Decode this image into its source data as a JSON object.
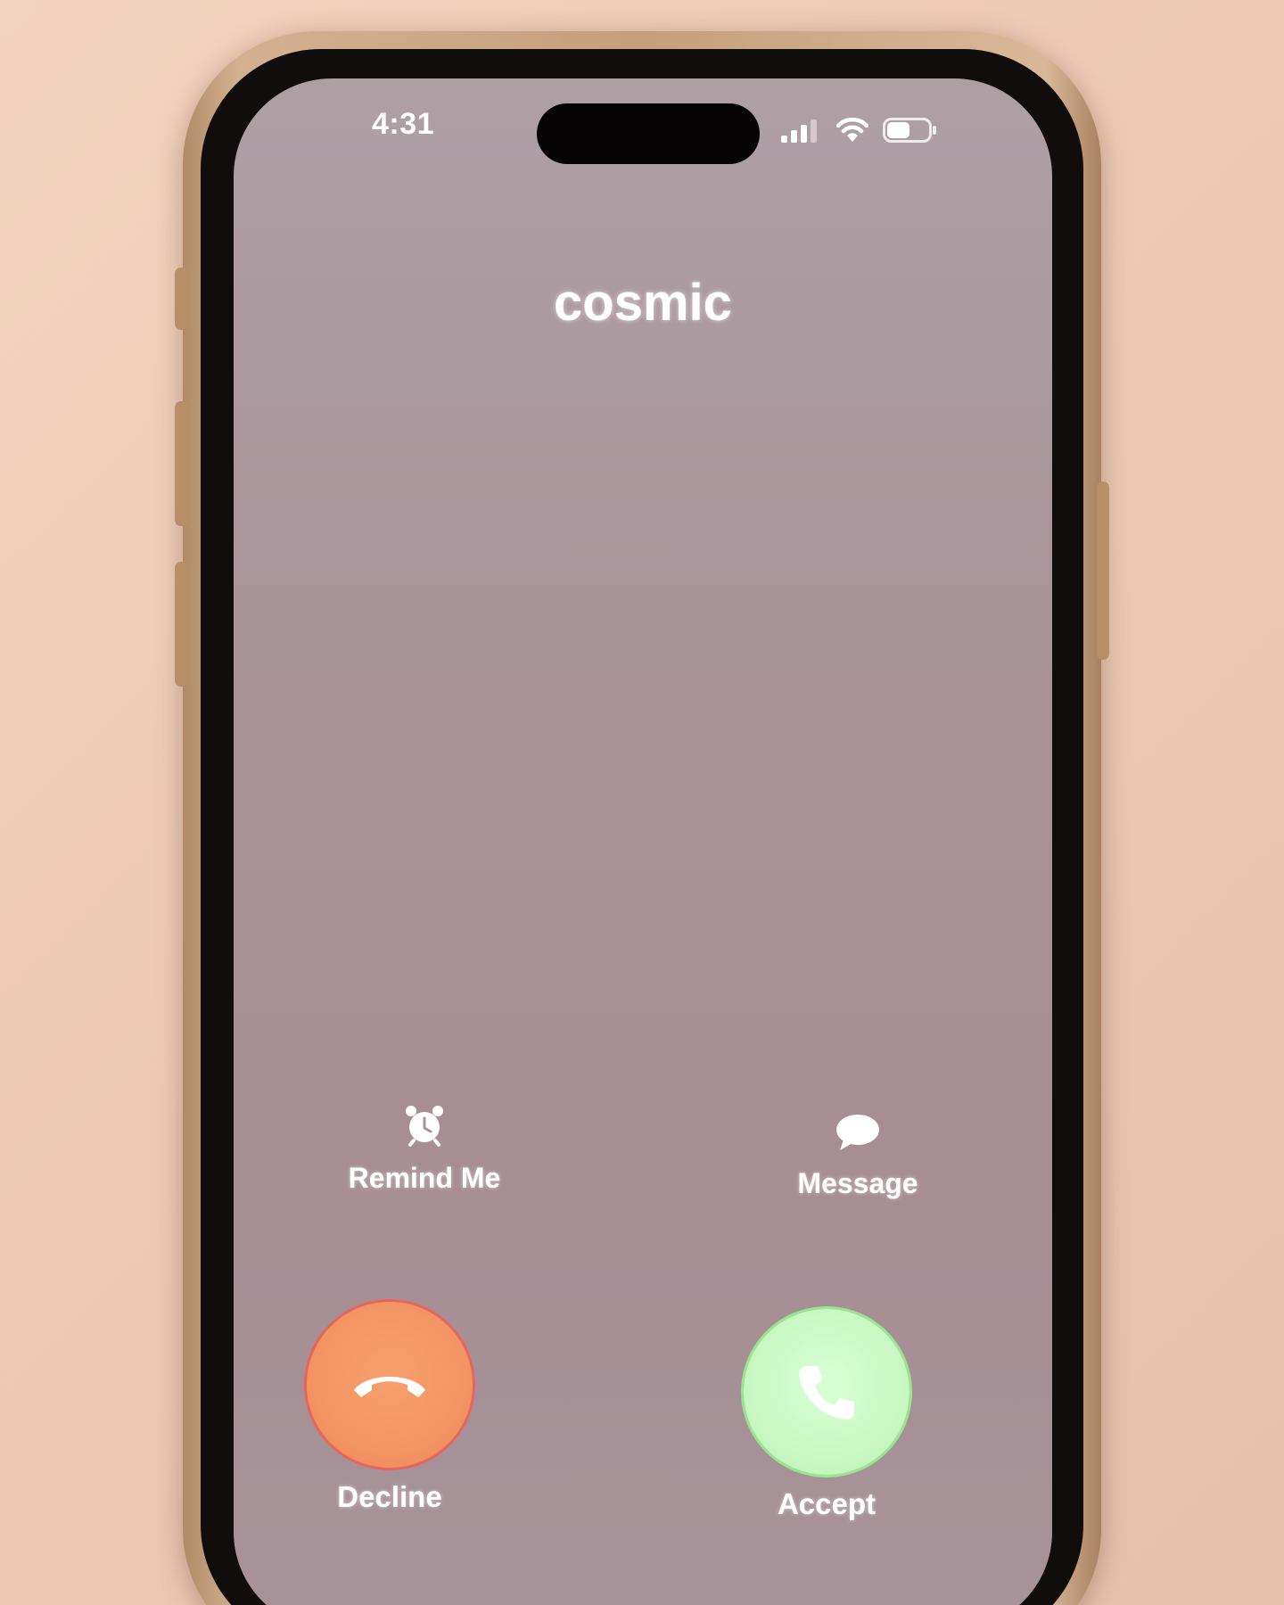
{
  "status_bar": {
    "time": "4:31",
    "icons": [
      "signal-icon",
      "wifi-icon",
      "battery-icon"
    ],
    "battery_level": 0.55
  },
  "caller": {
    "name": "cosmic"
  },
  "quick_actions": {
    "remind_me": {
      "label": "Remind Me",
      "icon": "alarm-clock-icon"
    },
    "message": {
      "label": "Message",
      "icon": "speech-bubble-icon"
    }
  },
  "call_buttons": {
    "decline": {
      "label": "Decline",
      "icon": "phone-hangup-icon",
      "color": "#f29262"
    },
    "accept": {
      "label": "Accept",
      "icon": "phone-icon",
      "color": "#c6f7c0"
    }
  },
  "colors": {
    "screen": "#a8949a",
    "case": "#c69f7b",
    "background": "#eccab5"
  }
}
